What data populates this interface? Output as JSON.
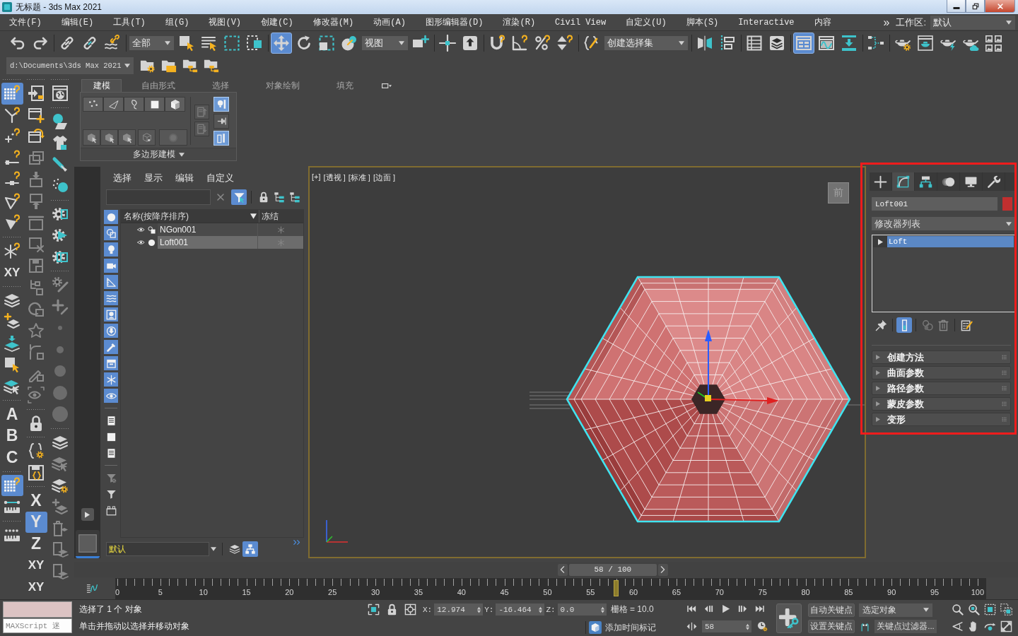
{
  "window": {
    "title": "无标题 - 3ds Max 2021"
  },
  "menu_bar": {
    "items": [
      "文件(F)",
      "编辑(E)",
      "工具(T)",
      "组(G)",
      "视图(V)",
      "创建(C)",
      "修改器(M)",
      "动画(A)",
      "图形编辑器(D)",
      "渲染(R)",
      "Civil View",
      "自定义(U)",
      "脚本(S)",
      "Interactive",
      "内容"
    ],
    "overflow": "»",
    "workspace_label": "工作区:",
    "workspace": "默认"
  },
  "main_toolbar": [
    {
      "kind": "button",
      "selected": false
    },
    {
      "kind": "button",
      "selected": false
    },
    {
      "kind": "separator"
    },
    {
      "kind": "button",
      "selected": false
    },
    {
      "kind": "button",
      "selected": false
    },
    {
      "kind": "button",
      "selected": false
    },
    {
      "kind": "separator"
    },
    {
      "kind": "dropdown",
      "value": "全部"
    },
    {
      "kind": "button",
      "selected": false
    },
    {
      "kind": "button",
      "selected": false
    },
    {
      "kind": "button",
      "selected": false
    },
    {
      "kind": "button",
      "selected": false
    },
    {
      "kind": "separator"
    },
    {
      "kind": "button",
      "selected": true
    },
    {
      "kind": "button",
      "selected": false
    },
    {
      "kind": "button",
      "selected": false
    },
    {
      "kind": "button",
      "selected": false
    },
    {
      "kind": "dropdown",
      "value": "视图"
    },
    {
      "kind": "button",
      "selected": false
    },
    {
      "kind": "separator"
    },
    {
      "kind": "button",
      "selected": false
    },
    {
      "kind": "button",
      "selected": false
    },
    {
      "kind": "separator"
    },
    {
      "kind": "button",
      "selected": false
    },
    {
      "kind": "button",
      "selected": false
    },
    {
      "kind": "button",
      "selected": false
    },
    {
      "kind": "button",
      "selected": false
    },
    {
      "kind": "separator"
    },
    {
      "kind": "button",
      "selected": false
    },
    {
      "kind": "dropdown",
      "value": "创建选择集"
    },
    {
      "kind": "separator"
    },
    {
      "kind": "button",
      "selected": false
    },
    {
      "kind": "button",
      "selected": false
    },
    {
      "kind": "separator"
    },
    {
      "kind": "button",
      "selected": false
    },
    {
      "kind": "button",
      "selected": false
    },
    {
      "kind": "separator"
    },
    {
      "kind": "button",
      "selected": true
    },
    {
      "kind": "button",
      "selected": false
    },
    {
      "kind": "button",
      "selected": false
    },
    {
      "kind": "separator"
    },
    {
      "kind": "button",
      "selected": false
    },
    {
      "kind": "separator"
    },
    {
      "kind": "button",
      "selected": false
    },
    {
      "kind": "button",
      "selected": false
    },
    {
      "kind": "button",
      "selected": false
    },
    {
      "kind": "button",
      "selected": false
    },
    {
      "kind": "button",
      "selected": false
    }
  ],
  "project_bar": {
    "path": "d:\\Documents\\3ds Max 2021"
  },
  "tool_strip": [
    [
      {
        "kind": "separator"
      },
      {
        "kind": "button",
        "selected": true
      },
      {
        "kind": "button",
        "selected": false
      },
      {
        "kind": "button",
        "selected": false
      },
      {
        "kind": "button",
        "selected": false
      },
      {
        "kind": "button",
        "selected": false
      },
      {
        "kind": "button",
        "selected": false
      },
      {
        "kind": "button",
        "selected": false
      },
      {
        "kind": "separator"
      },
      {
        "kind": "button",
        "selected": false
      },
      {
        "kind": "letter",
        "label": "XY",
        "selected": false
      },
      {
        "kind": "separator"
      },
      {
        "kind": "button",
        "selected": false
      },
      {
        "kind": "button",
        "selected": false
      },
      {
        "kind": "button",
        "selected": false
      },
      {
        "kind": "button",
        "selected": false
      },
      {
        "kind": "button",
        "selected": false
      },
      {
        "kind": "separator"
      },
      {
        "kind": "letter",
        "label": "A",
        "selected": false
      },
      {
        "kind": "letter",
        "label": "B",
        "selected": false
      },
      {
        "kind": "letter",
        "label": "C",
        "selected": false
      },
      {
        "kind": "separator"
      },
      {
        "kind": "button",
        "selected": true
      },
      {
        "kind": "button",
        "selected": false
      },
      {
        "kind": "separator"
      },
      {
        "kind": "button",
        "selected": false
      }
    ],
    [
      {
        "kind": "separator"
      },
      {
        "kind": "button",
        "selected": false
      },
      {
        "kind": "button",
        "selected": false
      },
      {
        "kind": "button",
        "selected": false
      },
      {
        "kind": "button",
        "selected": false
      },
      {
        "kind": "button",
        "selected": false
      },
      {
        "kind": "button",
        "selected": false
      },
      {
        "kind": "button",
        "selected": false
      },
      {
        "kind": "button",
        "selected": false
      },
      {
        "kind": "button",
        "selected": false
      },
      {
        "kind": "button",
        "selected": false
      },
      {
        "kind": "button",
        "selected": false
      },
      {
        "kind": "button",
        "selected": false
      },
      {
        "kind": "button",
        "selected": false
      },
      {
        "kind": "button",
        "selected": false
      },
      {
        "kind": "button",
        "selected": false
      },
      {
        "kind": "separator"
      },
      {
        "kind": "button",
        "selected": false
      },
      {
        "kind": "separator"
      },
      {
        "kind": "button",
        "selected": false
      },
      {
        "kind": "button",
        "selected": false
      },
      {
        "kind": "separator"
      },
      {
        "kind": "letter",
        "label": "X",
        "selected": false
      },
      {
        "kind": "letter",
        "label": "Y",
        "selected": true
      },
      {
        "kind": "letter",
        "label": "Z",
        "selected": false
      },
      {
        "kind": "letter",
        "label": "XY",
        "selected": false
      },
      {
        "kind": "letter",
        "label": "XY",
        "selected": false
      }
    ],
    [
      {
        "kind": "separator"
      },
      {
        "kind": "button",
        "selected": false
      },
      {
        "kind": "separator"
      },
      {
        "kind": "button",
        "selected": false
      },
      {
        "kind": "button",
        "selected": false
      },
      {
        "kind": "button",
        "selected": false
      },
      {
        "kind": "button",
        "selected": false
      },
      {
        "kind": "separator"
      },
      {
        "kind": "button",
        "selected": false
      },
      {
        "kind": "button",
        "selected": false
      },
      {
        "kind": "button",
        "selected": false
      },
      {
        "kind": "separator"
      },
      {
        "kind": "button",
        "selected": false
      },
      {
        "kind": "button",
        "selected": false
      },
      {
        "kind": "button",
        "selected": false
      },
      {
        "kind": "button",
        "selected": false
      },
      {
        "kind": "button",
        "selected": false
      },
      {
        "kind": "button",
        "selected": false
      },
      {
        "kind": "button",
        "selected": false
      },
      {
        "kind": "separator"
      },
      {
        "kind": "button",
        "selected": false
      },
      {
        "kind": "button",
        "selected": false
      },
      {
        "kind": "button",
        "selected": false
      },
      {
        "kind": "button",
        "selected": false
      },
      {
        "kind": "button",
        "selected": false
      },
      {
        "kind": "button",
        "selected": false
      },
      {
        "kind": "button",
        "selected": false
      }
    ]
  ],
  "ribbon": {
    "tabs": [
      {
        "label": "建模",
        "selected": true
      },
      {
        "label": "自由形式",
        "selected": false
      },
      {
        "label": "选择",
        "selected": false
      },
      {
        "label": "对象绘制",
        "selected": false
      },
      {
        "label": "填充",
        "selected": false
      }
    ],
    "toggles": [
      {
        "on": true
      },
      {
        "on": false
      },
      {
        "on": true
      }
    ],
    "panel_title": "多边形建模"
  },
  "scene_explorer": {
    "menu": [
      "选择",
      "显示",
      "编辑",
      "自定义"
    ],
    "filter_on": true,
    "filters": [
      {
        "on": true
      },
      {
        "on": true
      },
      {
        "on": true
      },
      {
        "on": true
      },
      {
        "on": true
      },
      {
        "on": true
      },
      {
        "on": true
      },
      {
        "on": true
      },
      {
        "on": true
      },
      {
        "on": true
      },
      {
        "on": true
      },
      {
        "on": true
      },
      {
        "on": false
      },
      {
        "on": false
      },
      {
        "on": false
      }
    ],
    "columns": [
      "名称(按降序排序)",
      "冻结"
    ],
    "rows": [
      {
        "name": "NGon001",
        "kind": "shape",
        "selected": false
      },
      {
        "name": "Loft001",
        "kind": "geometry",
        "selected": true
      }
    ],
    "layer": "默认",
    "hierarchy_on": true
  },
  "viewport": {
    "labels": [
      "[+]",
      "[透视 ]",
      "[标准 ]",
      "[边面 ]"
    ],
    "viewcube": "前"
  },
  "command_panel": {
    "tabs": [
      {
        "selected": false
      },
      {
        "selected": true
      },
      {
        "selected": false
      },
      {
        "selected": false
      },
      {
        "selected": false
      },
      {
        "selected": false
      }
    ],
    "object_name": "Loft001",
    "modifier_list": "修改器列表",
    "stack": [
      {
        "label": "Loft",
        "selected": true,
        "expanded": false
      }
    ],
    "show_end_result": true,
    "rollouts": [
      {
        "label": "创建方法",
        "expanded": false
      },
      {
        "label": "曲面参数",
        "expanded": false
      },
      {
        "label": "路径参数",
        "expanded": false
      },
      {
        "label": "蒙皮参数",
        "expanded": false
      },
      {
        "label": "变形",
        "expanded": false
      }
    ]
  },
  "time_slider": {
    "label": "58 / 100",
    "level": 0.58
  },
  "timeline": {
    "labels": [
      "0",
      "5",
      "10",
      "15",
      "20",
      "25",
      "30",
      "35",
      "40",
      "45",
      "50",
      "55",
      "60",
      "65",
      "70",
      "75",
      "80",
      "85",
      "90",
      "95",
      "100"
    ],
    "level": 0.58
  },
  "status_bar": {
    "listener": "MAXScript 迷",
    "selection": "选择了 1 个 对象",
    "prompt": "单击并拖动以选择并移动对象",
    "coordinates": [
      {
        "axis": "X:",
        "value": "12.974"
      },
      {
        "axis": "Y:",
        "value": "-16.464"
      },
      {
        "axis": "Z:",
        "value": "0.0"
      }
    ],
    "grid": "栅格 = 10.0",
    "time_tag": "添加时间标记",
    "frame": "58",
    "auto_key": {
      "label": "自动关键点",
      "on": false
    },
    "set_key": "设置关键点",
    "key_target": "选定对象",
    "key_filters": "关键点过滤器..."
  }
}
